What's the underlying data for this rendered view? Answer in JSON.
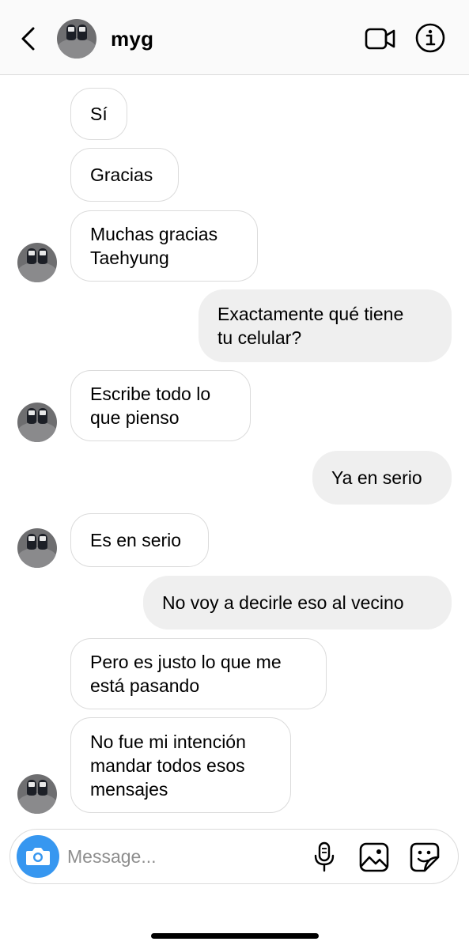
{
  "header": {
    "name": "myg",
    "back_icon": "chevron-left-icon",
    "video_icon": "video-camera-icon",
    "info_icon": "info-icon"
  },
  "messages": [
    {
      "direction": "incoming",
      "lines": [
        "Sí"
      ]
    },
    {
      "direction": "incoming",
      "lines": [
        "Gracias"
      ]
    },
    {
      "direction": "incoming",
      "lines": [
        "Muchas gracias",
        "Taehyung"
      ]
    },
    {
      "direction": "outgoing",
      "lines": [
        "Exactamente qué tiene",
        "tu celular?"
      ]
    },
    {
      "direction": "incoming",
      "lines": [
        "Escribe todo lo",
        "que pienso"
      ]
    },
    {
      "direction": "outgoing",
      "lines": [
        "Ya en serio"
      ]
    },
    {
      "direction": "incoming",
      "lines": [
        "Es en serio"
      ]
    },
    {
      "direction": "outgoing",
      "lines": [
        "No voy a decirle eso al vecino"
      ]
    },
    {
      "direction": "incoming",
      "lines": [
        "Pero es justo lo que me",
        "está pasando"
      ]
    },
    {
      "direction": "incoming",
      "lines": [
        "No fue mi intención",
        "mandar todos esos",
        "mensajes"
      ]
    }
  ],
  "composer": {
    "placeholder": "Message...",
    "value": "",
    "camera_icon": "camera-icon",
    "mic_icon": "microphone-icon",
    "gallery_icon": "gallery-icon",
    "sticker_icon": "sticker-icon"
  },
  "colors": {
    "header_bg": "#fafafa",
    "outgoing_bubble": "#efefef",
    "incoming_border": "#dbdbdb",
    "camera_blue": "#3797f0",
    "placeholder": "#8e8e8e"
  }
}
